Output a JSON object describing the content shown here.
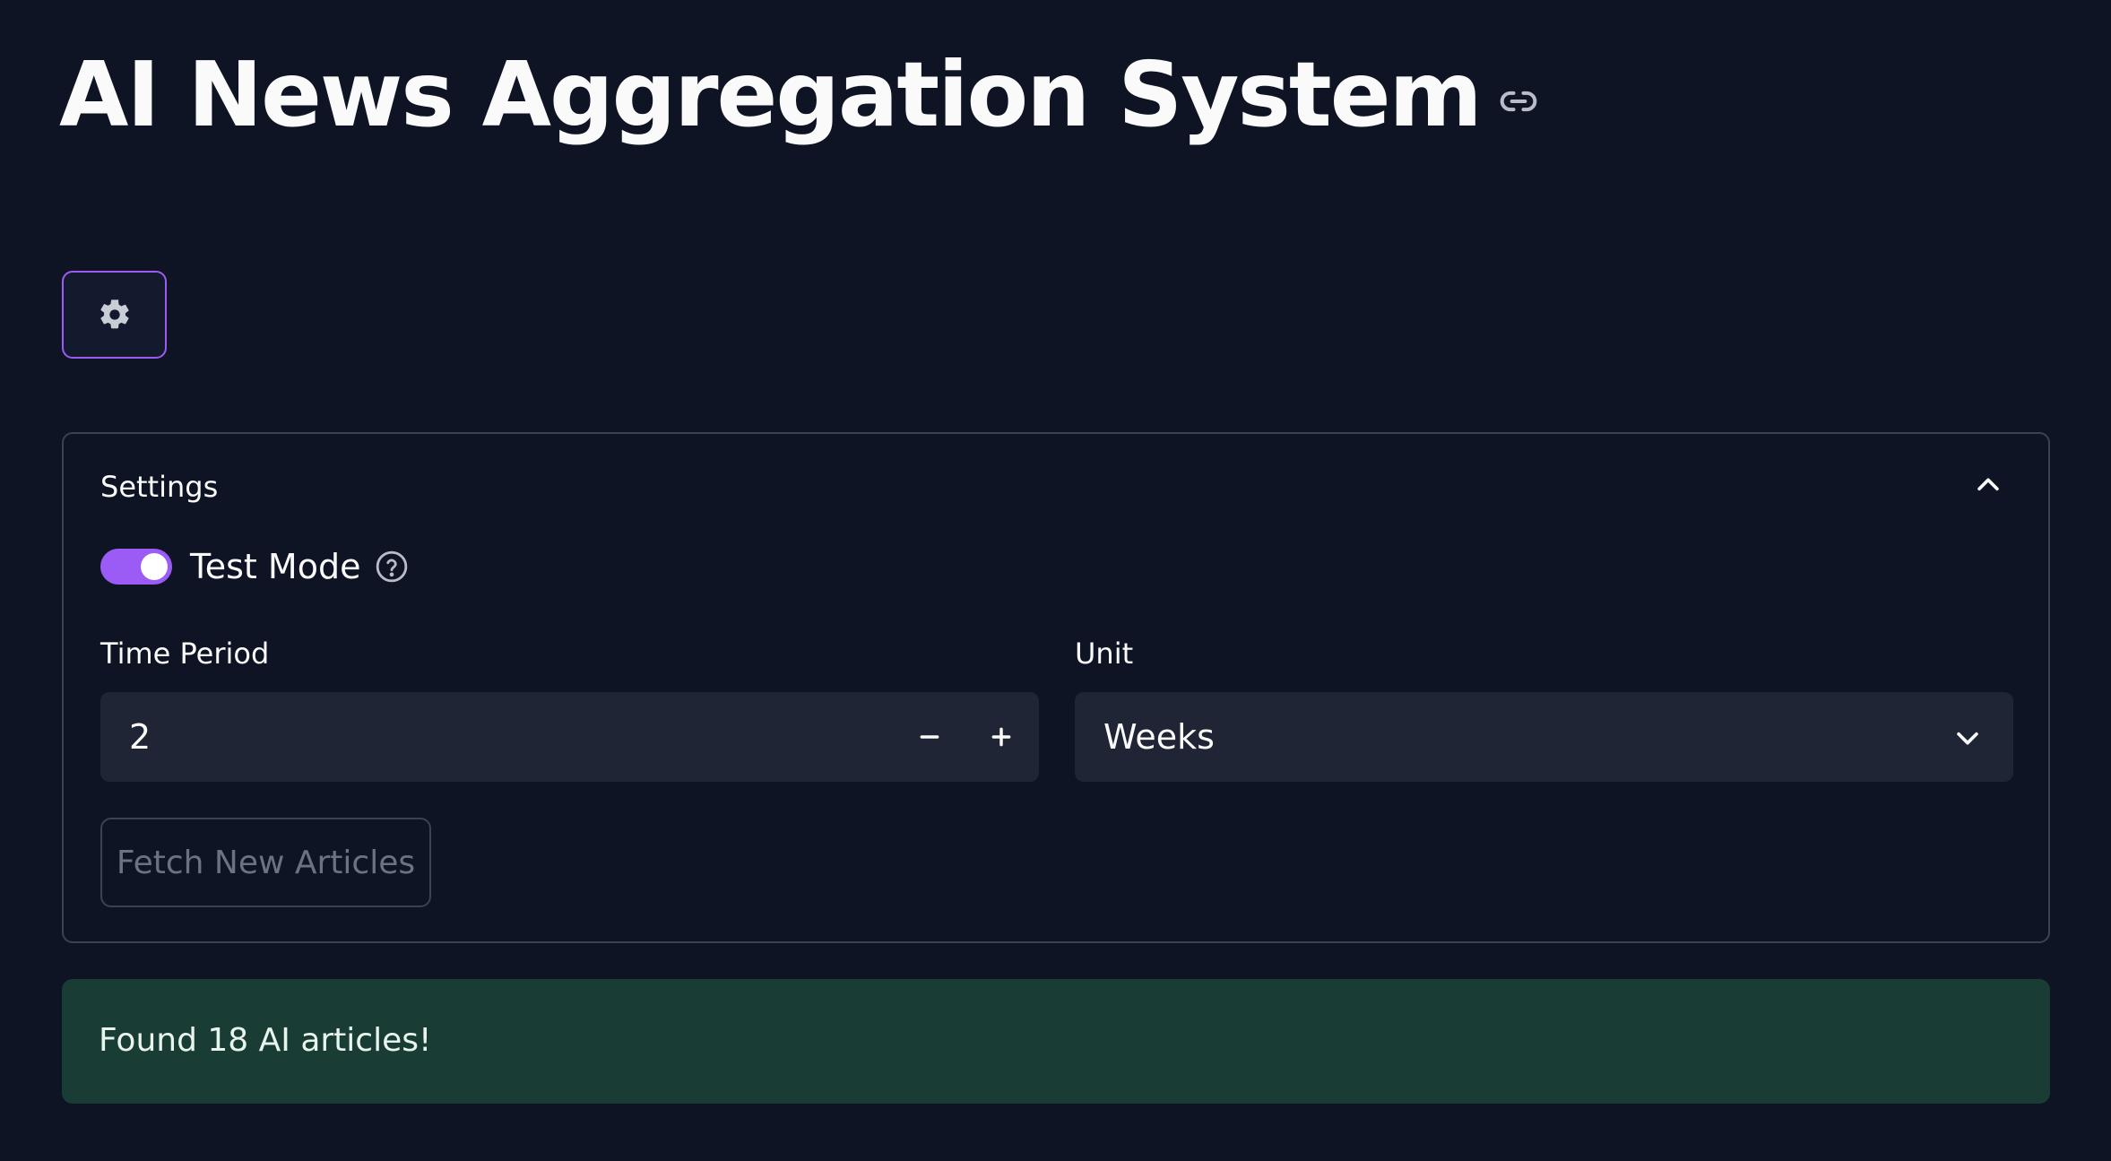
{
  "header": {
    "title": "AI News Aggregation System",
    "link_icon": "link-icon"
  },
  "toolbar": {
    "settings_icon": "gear-icon"
  },
  "settings": {
    "title": "Settings",
    "expanded": true,
    "test_mode": {
      "label": "Test Mode",
      "enabled": true
    },
    "time_period": {
      "label": "Time Period",
      "value": "2"
    },
    "unit": {
      "label": "Unit",
      "value": "Weeks"
    },
    "fetch_button_label": "Fetch New Articles"
  },
  "alert": {
    "text": "Found 18 AI articles!"
  },
  "colors": {
    "background": "#0e1424",
    "accent": "#9a5cf5",
    "input_bg": "#1f2535",
    "success_bg": "#193d35"
  }
}
